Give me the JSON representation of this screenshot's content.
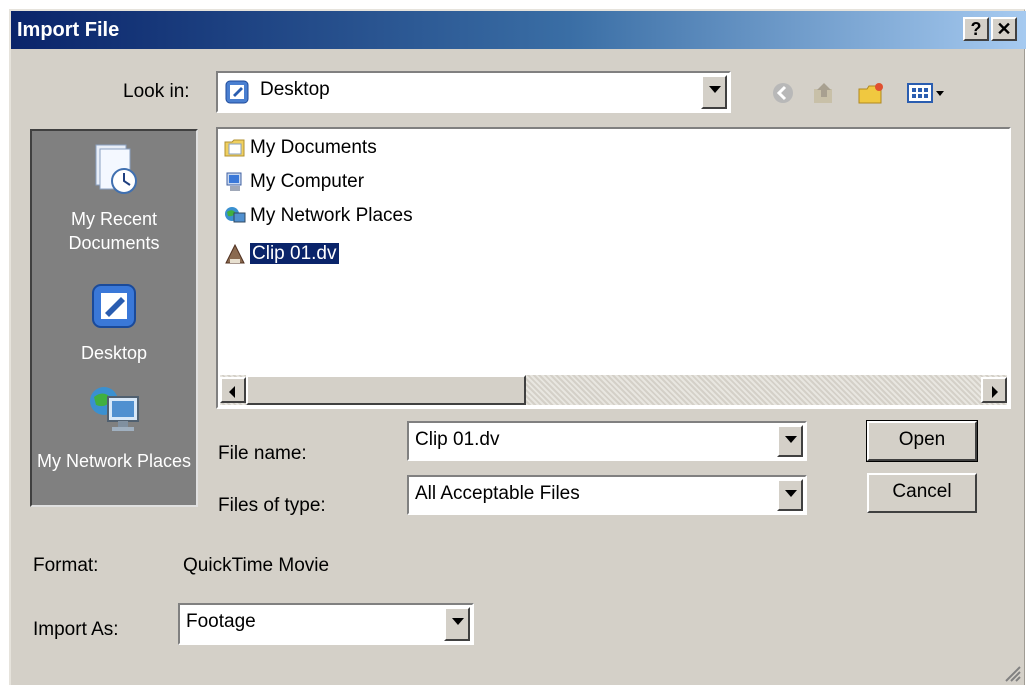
{
  "window": {
    "title": "Import File",
    "help_label": "?",
    "close_label": "✕"
  },
  "lookin": {
    "label": "Look in:",
    "value": "Desktop"
  },
  "places": [
    {
      "label": "My Recent Documents"
    },
    {
      "label": "Desktop"
    },
    {
      "label": "My Network Places"
    }
  ],
  "files": [
    {
      "name": "My Documents",
      "icon": "folder-documents-icon"
    },
    {
      "name": "My Computer",
      "icon": "computer-icon"
    },
    {
      "name": "My Network Places",
      "icon": "network-places-icon"
    },
    {
      "name": "Clip 01.dv",
      "icon": "dv-file-icon",
      "selected": true
    }
  ],
  "filename": {
    "label": "File name:",
    "value": "Clip 01.dv"
  },
  "filetype": {
    "label": "Files of type:",
    "value": "All Acceptable Files"
  },
  "buttons": {
    "open": "Open",
    "cancel": "Cancel"
  },
  "format": {
    "label": "Format:",
    "value": "QuickTime Movie"
  },
  "importas": {
    "label": "Import As:",
    "value": "Footage"
  },
  "colors": {
    "title_start": "#0a246a",
    "title_end": "#a6caf0",
    "face": "#d4d0c8",
    "selection": "#0a246a"
  }
}
